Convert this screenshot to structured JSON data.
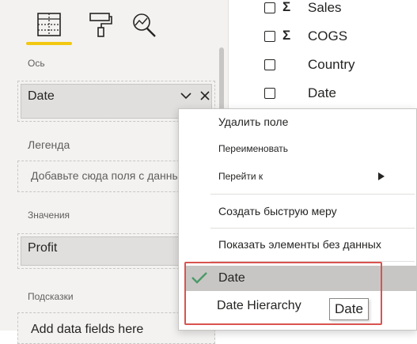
{
  "viz_pane": {
    "tabs": [
      {
        "icon": "fields-grid-icon",
        "active": true
      },
      {
        "icon": "format-paint-roller-icon",
        "active": false
      },
      {
        "icon": "analytics-magnifier-icon",
        "active": false
      }
    ],
    "accent_color": "#f2c811",
    "axis": {
      "label": "Ось",
      "field": "Date"
    },
    "legend": {
      "label": "Легенда",
      "placeholder": "Добавьте сюда поля с данными"
    },
    "values": {
      "label": "Значения",
      "field": "Profit"
    },
    "tooltips": {
      "label": "Подсказки",
      "placeholder": "Add data fields here"
    }
  },
  "fields_list": [
    {
      "name": "Sales",
      "sigma": "Σ",
      "checked": false
    },
    {
      "name": "COGS",
      "sigma": "Σ",
      "checked": false
    },
    {
      "name": "Country",
      "sigma": "",
      "checked": false
    },
    {
      "name": "Date",
      "sigma": "",
      "checked": false
    }
  ],
  "context_menu": {
    "remove_field": "Удалить поле",
    "rename": "Переименовать",
    "navigate": "Перейти к",
    "quick_measure": "Создать быструю меру",
    "show_no_data": "Показать элементы без данных",
    "date_option": "Date",
    "date_hierarchy_option": "Date Hierarchy",
    "checked_color": "#4c9a6a",
    "selected_bg": "#c8c6c4",
    "highlight_color": "#d9534f"
  },
  "tooltip": {
    "text": "Date"
  }
}
